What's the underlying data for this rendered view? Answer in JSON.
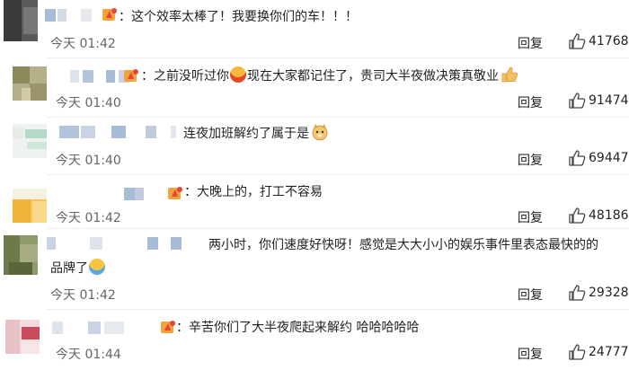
{
  "reply_label": "回复",
  "comments": [
    {
      "text": "：这个效率太棒了！我要换你们的车！！！",
      "time": "今天 01:42",
      "likes": "41768"
    },
    {
      "text_a": "：之前没听过你",
      "text_b": "现在大家都记住了，贵司大半夜做决策真敬业",
      "time": "今天 01:40",
      "likes": "91474"
    },
    {
      "text": "连夜加班解约了属于是",
      "time": "今天 01:40",
      "likes": "69447"
    },
    {
      "text": "：大晚上的，打工不容易",
      "time": "今天 01:42",
      "likes": "48186"
    },
    {
      "line1": "两小时，你们速度好快呀！感觉是大大小小的娱乐事件里表态最快的的",
      "line2": "品牌了",
      "time": "今天 01:42",
      "likes": "29328"
    },
    {
      "text": "：辛苦你们了大半夜爬起来解约 哈哈哈哈哈",
      "time": "今天 01:44",
      "likes": "24777"
    }
  ]
}
